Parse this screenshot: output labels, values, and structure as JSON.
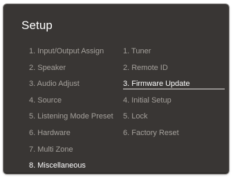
{
  "screen": {
    "title": "Setup"
  },
  "main_menu": [
    {
      "label": "1. Input/Output Assign"
    },
    {
      "label": "2. Speaker"
    },
    {
      "label": "3. Audio Adjust"
    },
    {
      "label": "4. Source"
    },
    {
      "label": "5. Listening Mode Preset"
    },
    {
      "label": "6. Hardware"
    },
    {
      "label": "7. Multi Zone"
    },
    {
      "label": "8. Miscellaneous"
    }
  ],
  "sub_menu": [
    {
      "label": "1. Tuner"
    },
    {
      "label": "2. Remote ID"
    },
    {
      "label": "3. Firmware Update"
    },
    {
      "label": "4. Initial Setup"
    },
    {
      "label": "5. Lock"
    },
    {
      "label": "6. Factory Reset"
    }
  ],
  "colors": {
    "panel_bg": "#393634",
    "text_dim": "#a5a19c",
    "text_active": "#ffffff"
  }
}
